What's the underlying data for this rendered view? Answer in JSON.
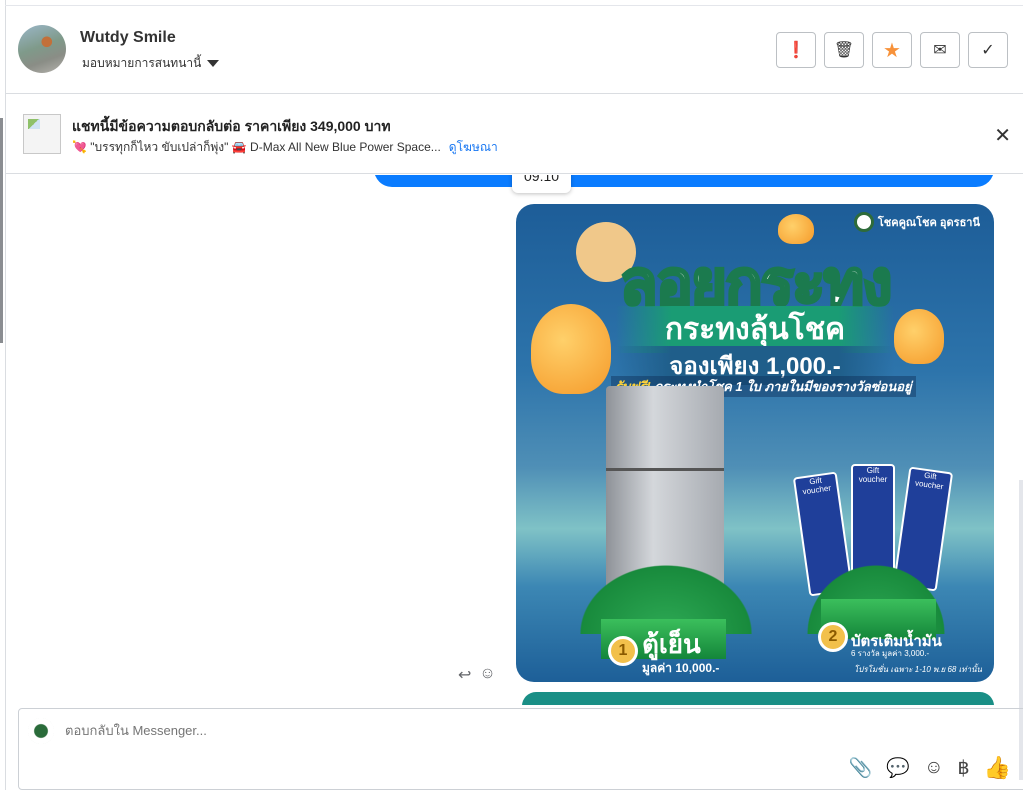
{
  "header": {
    "name": "Wutdy Smile",
    "assign_label": "มอบหมายการสนทนานี้"
  },
  "actions": [
    {
      "name": "spam",
      "glyph": "❗"
    },
    {
      "name": "delete",
      "glyph": "🗑"
    },
    {
      "name": "star",
      "glyph": "★"
    },
    {
      "name": "mark-unread",
      "glyph": "✉"
    },
    {
      "name": "done",
      "glyph": "✓"
    }
  ],
  "ad": {
    "title": "แชทนี้มีข้อความตอบกลับต่อ ราคาเพียง 349,000 บาท",
    "subtitle": "💘 \"บรรทุกก็ไหว ขับเปล่าก็พุ่ง\" 🚘 D-Max All New Blue Power Space...",
    "link": "ดูโฆษณา",
    "close": "✕"
  },
  "chat": {
    "timestamp": "09:10"
  },
  "poster": {
    "brand": "โชคคูณโชค อุดรธานี",
    "title": "ลอยกระทง",
    "subtitle": "กระทงลุ้นโชค",
    "price": "จองเพียง 1,000.-",
    "free_label": "รับฟรี!",
    "free_text": "กระทงนำโชค 1 ใบ ภายในมีของรางวัลซ่อนอยู่",
    "voucher_label": "Gift voucher",
    "prize1_num": "1",
    "prize1": "ตู้เย็น",
    "prize1_value": "มูลค่า 10,000.-",
    "prize2_num": "2",
    "prize2": "บัตรเติมน้ำมัน",
    "prize2_value": "6 รางวัล มูลค่า 3,000.-",
    "promo": "โปรโมชั่น เฉพาะ 1-10 พ.ย 68 เท่านั้น"
  },
  "message_actions": {
    "reply": "↩",
    "react": "☺"
  },
  "composer": {
    "placeholder": "ตอบกลับใน Messenger...",
    "tools": {
      "attach": "📎",
      "saved_reply": "💬",
      "emoji": "☺",
      "payment": "฿",
      "like": "👍"
    }
  },
  "colors": {
    "accent": "#1877f2",
    "bubble": "#0a7cff",
    "star": "#f7923a"
  }
}
